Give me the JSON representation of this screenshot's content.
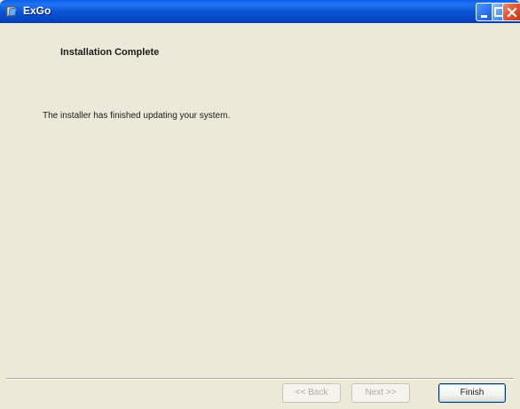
{
  "window": {
    "title": "ExGo",
    "colors": {
      "titlebar": "#0b55d7",
      "face": "#ece9d8",
      "close": "#e0502c"
    }
  },
  "titlebar_icons": {
    "app": "app-icon",
    "minimize": "minimize-icon",
    "maximize": "maximize-icon",
    "close": "close-icon"
  },
  "page": {
    "heading": "Installation Complete",
    "message": "The installer has finished updating your system."
  },
  "buttons": {
    "back_label": "<< Back",
    "next_label": "Next >>",
    "finish_label": "Finish"
  }
}
